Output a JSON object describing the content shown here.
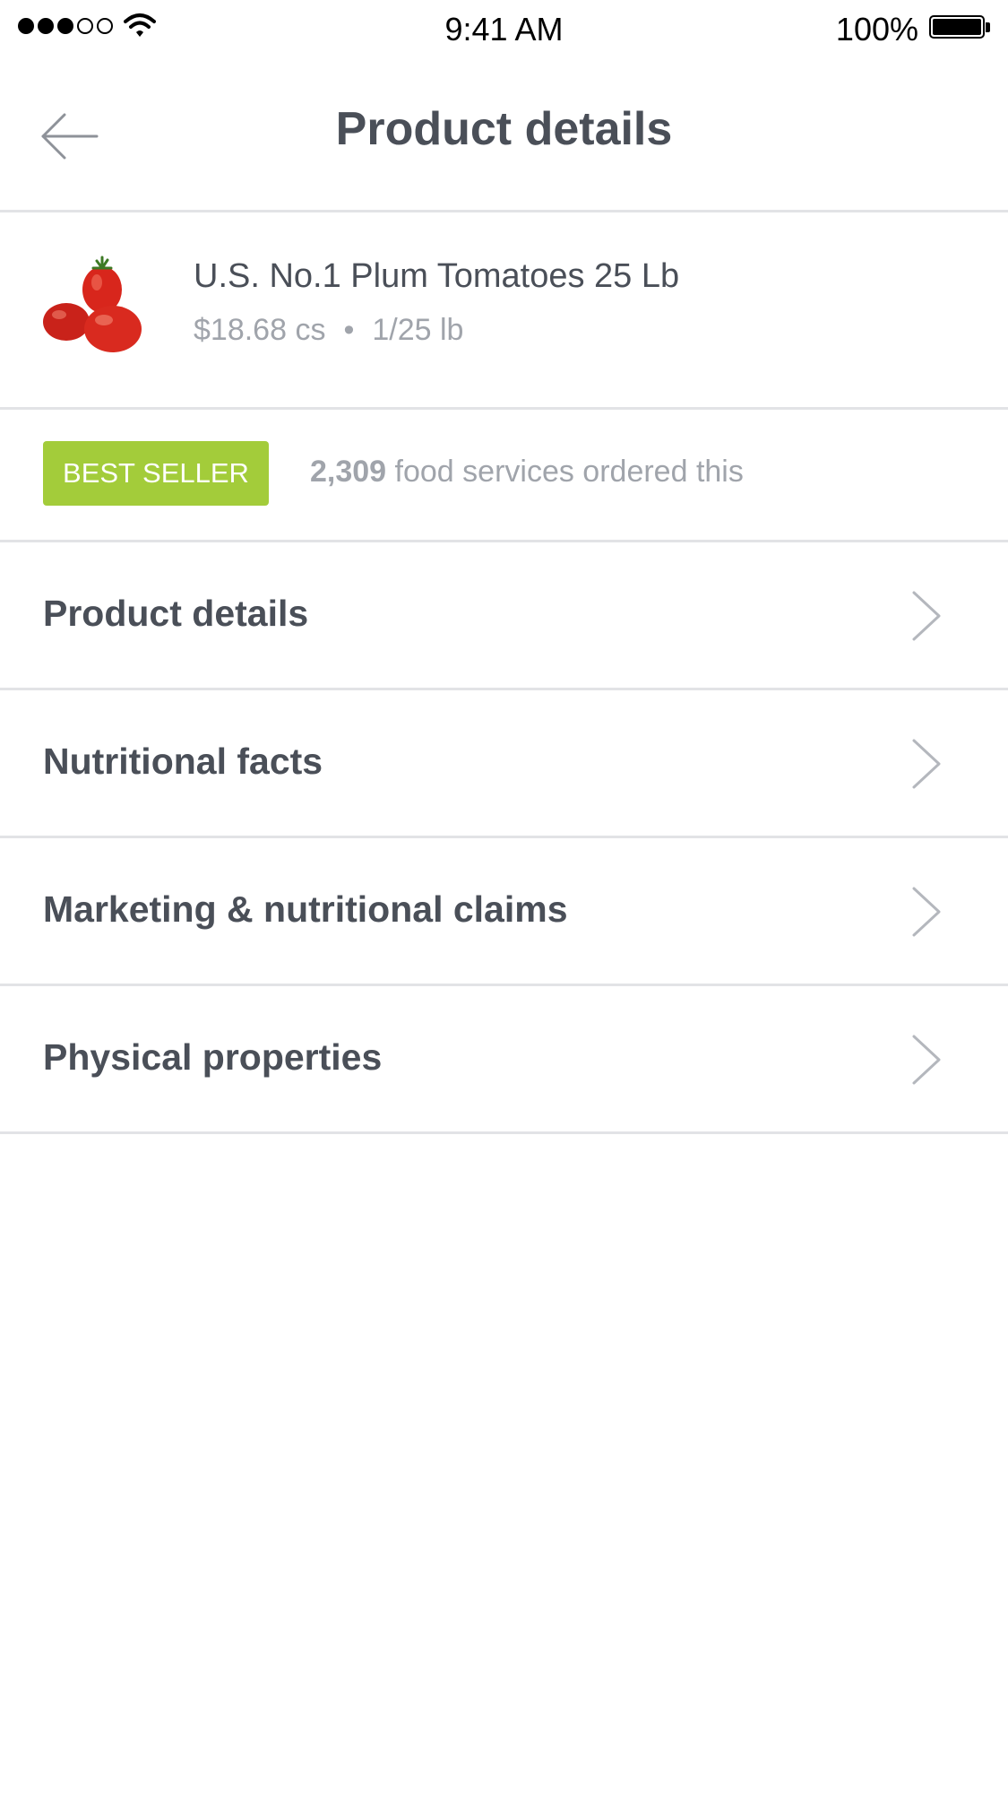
{
  "status_bar": {
    "time": "9:41 AM",
    "battery_percent": "100%",
    "signal_bars_filled": 3,
    "signal_bars_total": 5
  },
  "nav": {
    "title": "Product details",
    "back_icon": "arrow-left-icon"
  },
  "product": {
    "name": "U.S. No.1 Plum Tomatoes 25 Lb",
    "price": "$18.68 cs",
    "separator": "•",
    "pack_size": "1/25 lb",
    "image": "tomatoes-image"
  },
  "best_seller": {
    "badge_label": "BEST SELLER",
    "order_count": "2,309",
    "order_text": " food services ordered this",
    "badge_color": "#a3cc3a"
  },
  "menu": {
    "items": [
      {
        "label": "Product details",
        "icon": "chevron-right-icon"
      },
      {
        "label": "Nutritional facts",
        "icon": "chevron-right-icon"
      },
      {
        "label": "Marketing & nutritional claims",
        "icon": "chevron-right-icon"
      },
      {
        "label": "Physical properties",
        "icon": "chevron-right-icon"
      }
    ]
  }
}
